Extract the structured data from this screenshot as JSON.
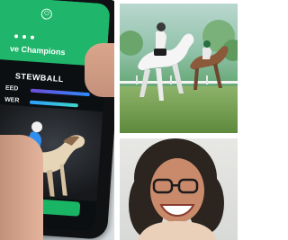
{
  "left_panel": {
    "icon": "power-icon",
    "banner_title": "ve Champions",
    "horse_name": "STEWBALL",
    "stats": [
      {
        "label": "EED",
        "value": 0.85
      },
      {
        "label": "WER",
        "value": 0.7
      }
    ],
    "accent": "#1fb56a"
  },
  "top_right_panel": {
    "scene": "horse-race-illustration"
  },
  "bottom_right_panel": {
    "scene": "smiling-woman-photo"
  }
}
